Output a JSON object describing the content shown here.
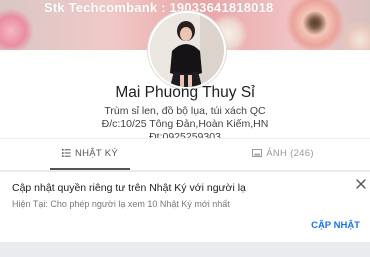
{
  "cover": {
    "banner_text": "Stk Techcombank : 19033641818018"
  },
  "profile": {
    "name": "Mai Phuong Thuy Sỉ",
    "bio": [
      "Trùm sỉ len, đồ bộ lụa, túi xách QC",
      "Đ/c:10/25 Tông Đản,Hoàn Kiếm,HN",
      "Đt:0925259303"
    ]
  },
  "tabs": {
    "diary_label": "NHẬT KÝ",
    "photos_label": "ẢNH (246)"
  },
  "notice": {
    "title": "Cập nhật quyền riêng tư trên Nhật Ký với người lạ",
    "subtitle": "Hiện Tại: Cho phép người lạ xem 10 Nhật Ký mới nhất",
    "action_label": "CẬP NHẬT"
  },
  "colors": {
    "accent": "#1a73e8",
    "cover_pink": "#e9a6a8"
  }
}
